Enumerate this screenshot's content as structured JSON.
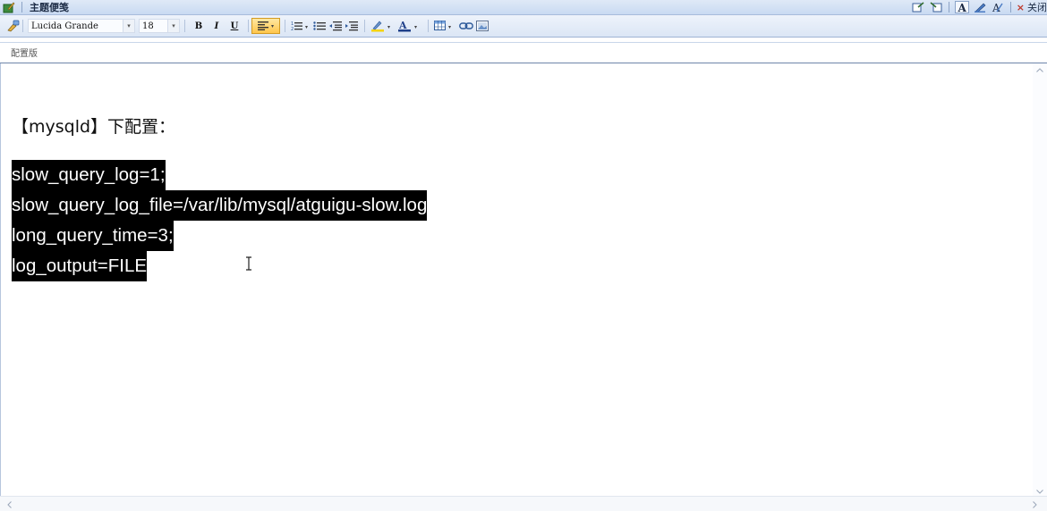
{
  "titlebar": {
    "title": "主题便笺",
    "close_label": "关闭",
    "close_glyph": "×"
  },
  "toolbar": {
    "font_name": "Lucida Grande",
    "font_size": "18",
    "bold_label": "B",
    "italic_label": "I",
    "underline_label": "U",
    "dropdown_glyph": "▾"
  },
  "tab": {
    "label": "配置版"
  },
  "content": {
    "heading": "【mysqld】下配置：",
    "lines": [
      "slow_query_log=1;",
      "slow_query_log_file=/var/lib/mysql/atguigu-slow.log",
      "long_query_time=3;",
      "log_output=FILE"
    ]
  },
  "colors": {
    "selection_bg": "#000000",
    "selection_fg": "#ffffff",
    "active_button": "#ffc64c",
    "toolbar_bg": "#dbe6f5"
  },
  "icons": {
    "app": "note-edit-icon",
    "brush": "format-painter-icon",
    "align": "align-left-icon",
    "numbered_list": "numbered-list-icon",
    "bullet_list": "bullet-list-icon",
    "outdent": "decrease-indent-icon",
    "indent": "increase-indent-icon",
    "highlight": "highlight-pen-icon",
    "font_color": "font-color-icon",
    "table": "table-icon",
    "link": "link-icon",
    "image": "image-icon"
  }
}
